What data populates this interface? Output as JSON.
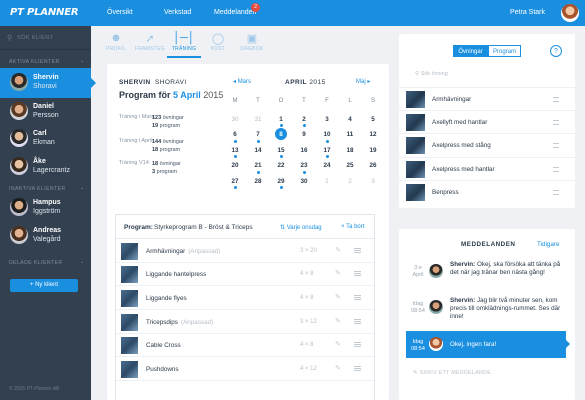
{
  "app": {
    "logo": "PT PLANNER"
  },
  "header": {
    "nav": [
      "Översikt",
      "Verkstad",
      "Meddelanden"
    ],
    "badge": "2",
    "user": "Petra Stark"
  },
  "sidebar": {
    "search_placeholder": "SÖK KLIENT",
    "active_section": "AKTIVA KLIENTER",
    "active_clients": [
      {
        "first": "Shervin",
        "last": "Shoravi"
      },
      {
        "first": "Daniel",
        "last": "Persson"
      },
      {
        "first": "Carl",
        "last": "Ekman"
      },
      {
        "first": "Åke",
        "last": "Lagercrantz"
      }
    ],
    "inactive_section": "INAKTIVA KLIENTER",
    "inactive_clients": [
      {
        "first": "Hampus",
        "last": "Iggström"
      },
      {
        "first": "Andreas",
        "last": "Valegård"
      }
    ],
    "shared_section": "DELADE KLIENTER",
    "new_client": "Ny klient",
    "copyright": "© 2015 PT-Planner AB"
  },
  "tabs": [
    {
      "label": "PROFIL",
      "icon": "person-icon"
    },
    {
      "label": "FRAMSTEG",
      "icon": "progress-chart-icon"
    },
    {
      "label": "TRÄNING",
      "icon": "dumbbell-icon"
    },
    {
      "label": "KOST",
      "icon": "cutlery-icon"
    },
    {
      "label": "DAGBOK",
      "icon": "diary-icon"
    }
  ],
  "profile": {
    "first": "SHERVIN",
    "last": "SHORAVI",
    "program_prefix": "Program för",
    "program_date": "5 April",
    "program_year": "2015"
  },
  "stats": [
    {
      "label": "Träning i Mars:",
      "val1": "123",
      "unit1": "övningar",
      "val2": "19",
      "unit2": "program"
    },
    {
      "label": "Träning i April:",
      "val1": "144",
      "unit1": "övningar",
      "val2": "18",
      "unit2": "program"
    },
    {
      "label": "Träning V14:",
      "val1": "18",
      "unit1": "övningar",
      "val2": "3",
      "unit2": "program"
    }
  ],
  "calendar": {
    "prev": "Mars",
    "next": "Maj",
    "month": "APRIL",
    "year": "2015",
    "weekdays": [
      "M",
      "T",
      "O",
      "T",
      "F",
      "L",
      "S"
    ],
    "weeks": [
      [
        "30",
        "31",
        "1",
        "2",
        "3",
        "4",
        "5"
      ],
      [
        "6",
        "7",
        "8",
        "9",
        "10",
        "11",
        "12"
      ],
      [
        "13",
        "14",
        "15",
        "16",
        "17",
        "18",
        "19"
      ],
      [
        "20",
        "21",
        "22",
        "23",
        "24",
        "25",
        "26"
      ],
      [
        "27",
        "28",
        "29",
        "30",
        "1",
        "2",
        "3"
      ]
    ]
  },
  "program": {
    "label": "Program:",
    "name": "Styrkeprogram B - Bröst & Triceps",
    "repeat": "Varje onsdag",
    "delete": "Ta bort",
    "exercises": [
      {
        "name": "Armhävningar",
        "note": "(Anpassad)",
        "sets": "3 × 20"
      },
      {
        "name": "Liggande hantelpress",
        "note": "",
        "sets": "4 × 8"
      },
      {
        "name": "Liggande flyes",
        "note": "",
        "sets": "4 × 8"
      },
      {
        "name": "Tricepsdips",
        "note": "(Anpassad)",
        "sets": "3 × 12"
      },
      {
        "name": "Cable Cross",
        "note": "",
        "sets": "4 × 8"
      },
      {
        "name": "Pushdowns",
        "note": "",
        "sets": "4 × 12"
      }
    ]
  },
  "library": {
    "tab_on": "Övningar",
    "tab_off": "Program",
    "help": "?",
    "search_placeholder": "Sök övning",
    "items": [
      "Armhävningar",
      "Axellyft med hantlar",
      "Axelpress med stång",
      "Axelpress med hantlar",
      "Benpress"
    ]
  },
  "messages": {
    "title": "MEDDELANDEN",
    "link": "Tidigare",
    "items": [
      {
        "time": "3:e April",
        "sender": "Shervin:",
        "text": "Okej, ska försöka att tänka på det när jag tränar ben nästa gång!"
      },
      {
        "time": "Idag 08:54",
        "sender": "Shervin:",
        "text": "Jag blir två minuter sen, kom precis till omklädnings-rummet. Ses där inne!"
      },
      {
        "time": "Idag 08:54",
        "sender": "",
        "text": "Okej, ingen fara!"
      }
    ],
    "write": "SKRIV ETT MEDDELANDE"
  },
  "colors": {
    "accent": "#1a8fe0",
    "sidebar": "#33404f",
    "badge": "#e74c3c"
  }
}
